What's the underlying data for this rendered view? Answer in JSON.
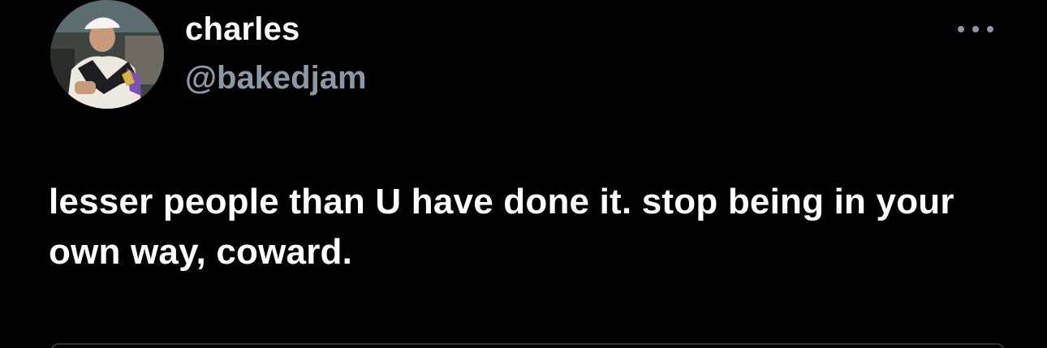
{
  "tweet": {
    "author": {
      "display_name": "charles",
      "handle": "@bakedjam",
      "avatar_icon": "user-avatar-photo"
    },
    "more_icon": "ellipsis-icon",
    "text": "lesser people than U have done it. stop being in your own way, coward."
  },
  "colors": {
    "background": "#000000",
    "primary_text": "#ffffff",
    "secondary_text": "#8b98a5",
    "border": "#2f3336"
  }
}
